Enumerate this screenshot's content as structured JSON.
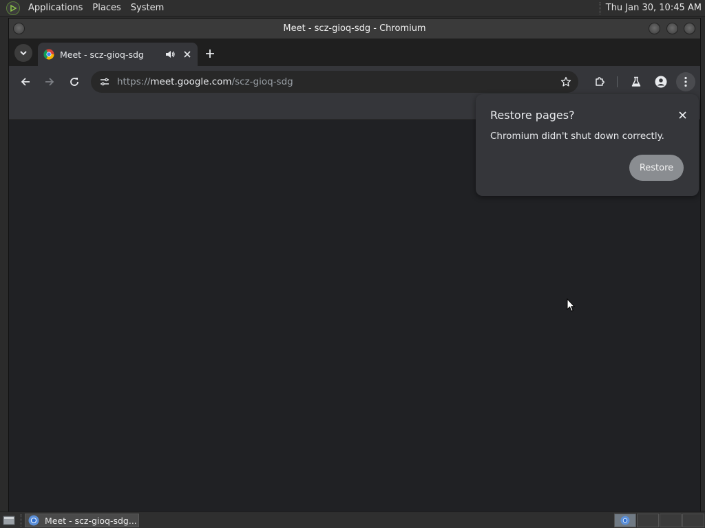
{
  "top_panel": {
    "menus": [
      "Applications",
      "Places",
      "System"
    ],
    "clock": "Thu Jan 30, 10:45 AM"
  },
  "window": {
    "title": "Meet - scz-gioq-sdg - Chromium"
  },
  "tabs": [
    {
      "title": "Meet - scz-gioq-sdg",
      "audio": true
    }
  ],
  "omnibox": {
    "scheme": "https://",
    "host": "meet.google.com",
    "path": "/scz-gioq-sdg"
  },
  "restore_dialog": {
    "title": "Restore pages?",
    "message": "Chromium didn't shut down correctly.",
    "button": "Restore"
  },
  "taskbar": {
    "window_label": "Meet - scz-gioq-sdg..."
  },
  "colors": {
    "page_background": "#202124",
    "toolbar": "#35363a",
    "restore_button": "#8a8d91"
  }
}
